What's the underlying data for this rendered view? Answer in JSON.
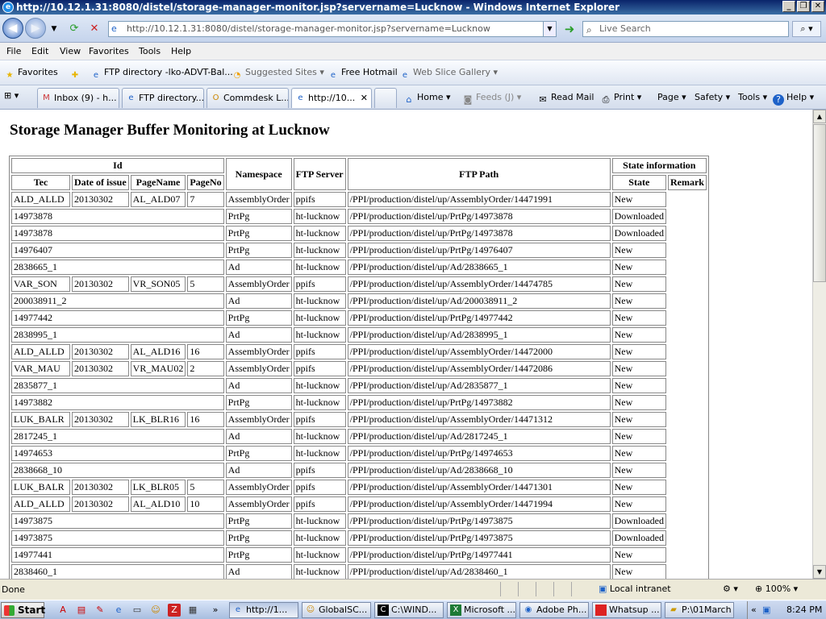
{
  "window": {
    "title": "http://10.12.1.31:8080/distel/storage-manager-monitor.jsp?servername=Lucknow - Windows Internet Explorer"
  },
  "address": {
    "url": "http://10.12.1.31:8080/distel/storage-manager-monitor.jsp?servername=Lucknow",
    "search_placeholder": "Live Search"
  },
  "menu": [
    "File",
    "Edit",
    "View",
    "Favorites",
    "Tools",
    "Help"
  ],
  "favorites": {
    "label": "Favorites",
    "items": [
      "FTP directory -lko-ADVT-Bal...",
      "Suggested Sites",
      "Free Hotmail",
      "Web Slice Gallery"
    ]
  },
  "tabs": [
    "Inbox (9) - h...",
    "FTP directory...",
    "Commdesk L...",
    "http://10..."
  ],
  "commands": [
    "Home",
    "Feeds (J)",
    "Read Mail",
    "Print",
    "Page",
    "Safety",
    "Tools",
    "Help"
  ],
  "page": {
    "title": "Storage Manager Buffer Monitoring at Lucknow"
  },
  "table": {
    "group_id": "Id",
    "group_state": "State information",
    "headers": {
      "tec": "Tec",
      "date": "Date of issue",
      "pagename": "PageName",
      "pageno": "PageNo",
      "namespace": "Namespace",
      "ftpserver": "FTP Server",
      "ftppath": "FTP Path",
      "state": "State",
      "remark": "Remark"
    },
    "rows": [
      {
        "tec": "ALD_ALLD",
        "date": "20130302",
        "pagename": "AL_ALD07",
        "pageno": "7",
        "ns": "AssemblyOrder",
        "srv": "ppifs",
        "path": "/PPI/production/distel/up/AssemblyOrder/14471991",
        "state": "New"
      },
      {
        "id": "14973878",
        "ns": "PrtPg",
        "srv": "ht-lucknow",
        "path": "/PPI/production/distel/up/PrtPg/14973878",
        "state": "Downloaded"
      },
      {
        "id": "14973878",
        "ns": "PrtPg",
        "srv": "ht-lucknow",
        "path": "/PPI/production/distel/up/PrtPg/14973878",
        "state": "Downloaded"
      },
      {
        "id": "14976407",
        "ns": "PrtPg",
        "srv": "ht-lucknow",
        "path": "/PPI/production/distel/up/PrtPg/14976407",
        "state": "New"
      },
      {
        "id": "2838665_1",
        "ns": "Ad",
        "srv": "ht-lucknow",
        "path": "/PPI/production/distel/up/Ad/2838665_1",
        "state": "New"
      },
      {
        "tec": "VAR_SON",
        "date": "20130302",
        "pagename": "VR_SON05",
        "pageno": "5",
        "ns": "AssemblyOrder",
        "srv": "ppifs",
        "path": "/PPI/production/distel/up/AssemblyOrder/14474785",
        "state": "New"
      },
      {
        "id": "200038911_2",
        "ns": "Ad",
        "srv": "ht-lucknow",
        "path": "/PPI/production/distel/up/Ad/200038911_2",
        "state": "New"
      },
      {
        "id": "14977442",
        "ns": "PrtPg",
        "srv": "ht-lucknow",
        "path": "/PPI/production/distel/up/PrtPg/14977442",
        "state": "New"
      },
      {
        "id": "2838995_1",
        "ns": "Ad",
        "srv": "ht-lucknow",
        "path": "/PPI/production/distel/up/Ad/2838995_1",
        "state": "New"
      },
      {
        "tec": "ALD_ALLD",
        "date": "20130302",
        "pagename": "AL_ALD16",
        "pageno": "16",
        "ns": "AssemblyOrder",
        "srv": "ppifs",
        "path": "/PPI/production/distel/up/AssemblyOrder/14472000",
        "state": "New"
      },
      {
        "tec": "VAR_MAU",
        "date": "20130302",
        "pagename": "VR_MAU02",
        "pageno": "2",
        "ns": "AssemblyOrder",
        "srv": "ppifs",
        "path": "/PPI/production/distel/up/AssemblyOrder/14472086",
        "state": "New"
      },
      {
        "id": "2835877_1",
        "ns": "Ad",
        "srv": "ht-lucknow",
        "path": "/PPI/production/distel/up/Ad/2835877_1",
        "state": "New"
      },
      {
        "id": "14973882",
        "ns": "PrtPg",
        "srv": "ht-lucknow",
        "path": "/PPI/production/distel/up/PrtPg/14973882",
        "state": "New"
      },
      {
        "tec": "LUK_BALR",
        "date": "20130302",
        "pagename": "LK_BLR16",
        "pageno": "16",
        "ns": "AssemblyOrder",
        "srv": "ppifs",
        "path": "/PPI/production/distel/up/AssemblyOrder/14471312",
        "state": "New"
      },
      {
        "id": "2817245_1",
        "ns": "Ad",
        "srv": "ht-lucknow",
        "path": "/PPI/production/distel/up/Ad/2817245_1",
        "state": "New"
      },
      {
        "id": "14974653",
        "ns": "PrtPg",
        "srv": "ht-lucknow",
        "path": "/PPI/production/distel/up/PrtPg/14974653",
        "state": "New"
      },
      {
        "id": "2838668_10",
        "ns": "Ad",
        "srv": "ppifs",
        "path": "/PPI/production/distel/up/Ad/2838668_10",
        "state": "New"
      },
      {
        "tec": "LUK_BALR",
        "date": "20130302",
        "pagename": "LK_BLR05",
        "pageno": "5",
        "ns": "AssemblyOrder",
        "srv": "ppifs",
        "path": "/PPI/production/distel/up/AssemblyOrder/14471301",
        "state": "New"
      },
      {
        "tec": "ALD_ALLD",
        "date": "20130302",
        "pagename": "AL_ALD10",
        "pageno": "10",
        "ns": "AssemblyOrder",
        "srv": "ppifs",
        "path": "/PPI/production/distel/up/AssemblyOrder/14471994",
        "state": "New"
      },
      {
        "id": "14973875",
        "ns": "PrtPg",
        "srv": "ht-lucknow",
        "path": "/PPI/production/distel/up/PrtPg/14973875",
        "state": "Downloaded"
      },
      {
        "id": "14973875",
        "ns": "PrtPg",
        "srv": "ht-lucknow",
        "path": "/PPI/production/distel/up/PrtPg/14973875",
        "state": "Downloaded"
      },
      {
        "id": "14977441",
        "ns": "PrtPg",
        "srv": "ht-lucknow",
        "path": "/PPI/production/distel/up/PrtPg/14977441",
        "state": "New"
      },
      {
        "id": "2838460_1",
        "ns": "Ad",
        "srv": "ht-lucknow",
        "path": "/PPI/production/distel/up/Ad/2838460_1",
        "state": "New"
      }
    ]
  },
  "status": {
    "text": "Done",
    "zone": "Local intranet",
    "zoom": "100%"
  },
  "taskbar": {
    "start": "Start",
    "tasks": [
      "http://1...",
      "GlobalSC...",
      "C:\\WIND...",
      "Microsoft ...",
      "Adobe Ph...",
      "Whatsup ...",
      "P:\\01March"
    ],
    "clock": "8:24 PM"
  },
  "colors": {
    "titlebar": "#0a246a",
    "ie_blue": "#3c6fc6"
  }
}
